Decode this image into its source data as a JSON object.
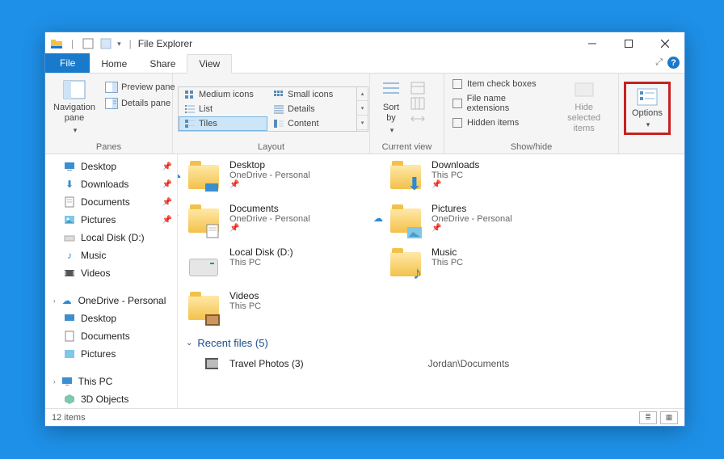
{
  "title": "File Explorer",
  "tabs": {
    "file": "File",
    "home": "Home",
    "share": "Share",
    "view": "View"
  },
  "ribbon": {
    "panes": {
      "label": "Panes",
      "navigation": "Navigation\npane",
      "preview": "Preview pane",
      "details": "Details pane"
    },
    "layout": {
      "label": "Layout",
      "medium": "Medium icons",
      "small": "Small icons",
      "list": "List",
      "details": "Details",
      "tiles": "Tiles",
      "content": "Content"
    },
    "currentview": {
      "label": "Current view",
      "sort": "Sort\nby"
    },
    "showhide": {
      "label": "Show/hide",
      "checkboxes": "Item check boxes",
      "extensions": "File name extensions",
      "hidden": "Hidden items",
      "hideselected": "Hide selected\nitems"
    },
    "options": "Options"
  },
  "nav": {
    "quick": [
      {
        "label": "Desktop",
        "pinned": true
      },
      {
        "label": "Downloads",
        "pinned": true
      },
      {
        "label": "Documents",
        "pinned": true
      },
      {
        "label": "Pictures",
        "pinned": true
      },
      {
        "label": "Local Disk (D:)"
      },
      {
        "label": "Music"
      },
      {
        "label": "Videos"
      }
    ],
    "onedrive": {
      "label": "OneDrive - Personal",
      "children": [
        {
          "label": "Desktop"
        },
        {
          "label": "Documents"
        },
        {
          "label": "Pictures"
        }
      ]
    },
    "thispc": {
      "label": "This PC",
      "children": [
        {
          "label": "3D Objects"
        }
      ]
    }
  },
  "tilesRow1": [
    {
      "name": "Desktop",
      "sub": "OneDrive - Personal",
      "badge": "cloud",
      "pinned": true
    },
    {
      "name": "Downloads",
      "sub": "This PC",
      "pinned": true,
      "accent": "down"
    }
  ],
  "tilesRow2": [
    {
      "name": "Documents",
      "sub": "OneDrive - Personal",
      "badge": "sync",
      "pinned": true,
      "doc": true
    },
    {
      "name": "Pictures",
      "sub": "OneDrive - Personal",
      "badge": "cloud",
      "pinned": true,
      "pic": true
    }
  ],
  "tilesRow3": [
    {
      "name": "Local Disk (D:)",
      "sub": "This PC",
      "drive": true
    },
    {
      "name": "Music",
      "sub": "This PC",
      "music": true
    }
  ],
  "tilesRow4": [
    {
      "name": "Videos",
      "sub": "This PC",
      "video": true
    }
  ],
  "recent": {
    "header": "Recent files (5)",
    "item": {
      "name": "Travel Photos (3)",
      "loc": "Jordan\\Documents"
    }
  },
  "status": {
    "count": "12 items"
  }
}
